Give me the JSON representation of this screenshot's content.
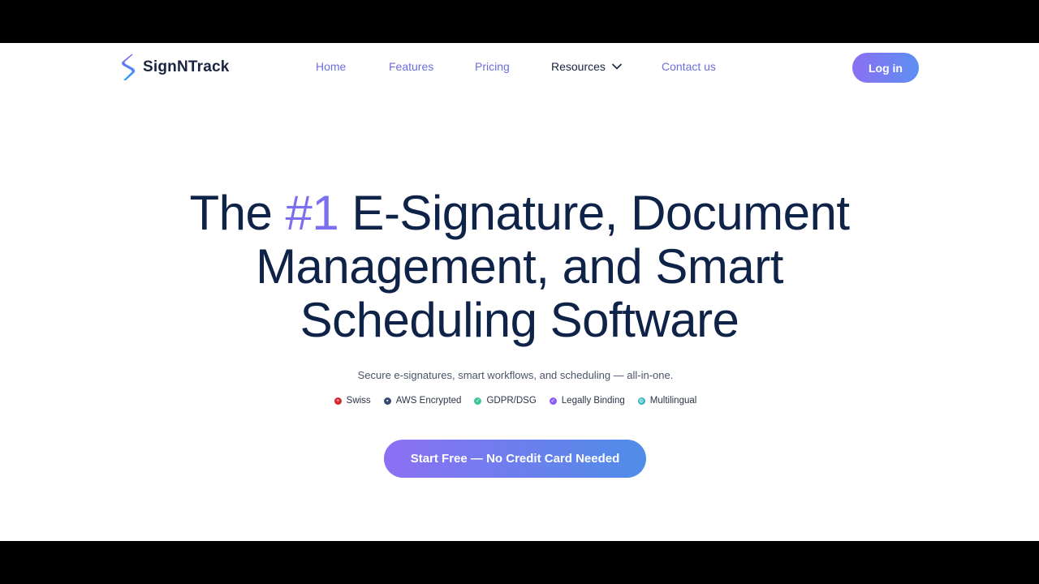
{
  "brand": {
    "name": "SignNTrack",
    "accent_color": "#7b6ff0",
    "text_color": "#0f2348"
  },
  "nav": {
    "items": [
      {
        "label": "Home"
      },
      {
        "label": "Features"
      },
      {
        "label": "Pricing"
      },
      {
        "label": "Resources",
        "icon": "chevron-down-icon"
      },
      {
        "label": "Contact us"
      }
    ],
    "login_label": "Log in"
  },
  "hero": {
    "title_prefix": "The ",
    "title_accent": "#1",
    "title_line1_rest": " E-Signature, Document",
    "title_line2": "Management, and Smart",
    "title_line3": "Scheduling Software",
    "subtitle": "Secure e-signatures, smart workflows, and scheduling — all-in-one.",
    "badges": [
      {
        "label": "Swiss",
        "icon": "swiss-flag-icon",
        "color": "#d8262f"
      },
      {
        "label": "AWS Encrypted",
        "icon": "lock-icon",
        "color": "#3b4a70"
      },
      {
        "label": "GDPR/DSG",
        "icon": "check-icon",
        "color": "#3cc59a"
      },
      {
        "label": "Legally Binding",
        "icon": "check-icon",
        "color": "#8b5cf6"
      },
      {
        "label": "Multilingual",
        "icon": "globe-icon",
        "color": "#2bb0c0"
      }
    ],
    "cta_label": "Start Free — No Credit Card Needed"
  }
}
